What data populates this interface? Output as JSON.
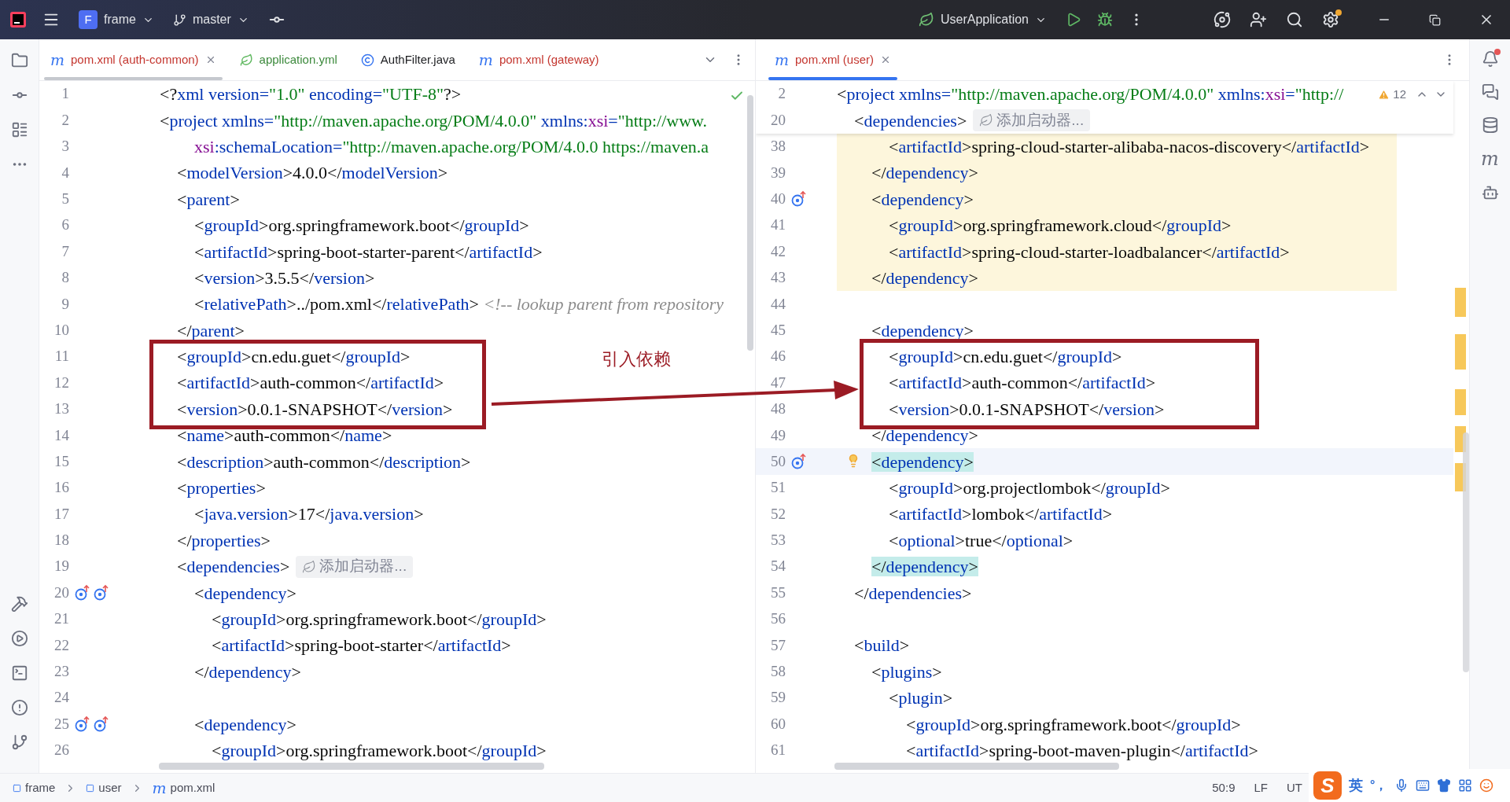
{
  "title_bar": {
    "project": {
      "badge": "F",
      "name": "frame"
    },
    "branch": "master",
    "run_config": "UserApplication"
  },
  "right_toolbar": {
    "maven_label": "m"
  },
  "left_editor": {
    "focused": false,
    "tabs": [
      {
        "kind": "maven",
        "icon_text": "m",
        "label": "pom.xml (auth-common)",
        "color": "#c4362f",
        "selected": true
      },
      {
        "kind": "yaml",
        "label": "application.yml",
        "color": "#3d8a3d",
        "selected": false
      },
      {
        "kind": "java",
        "label": "AuthFilter.java",
        "color": "#1e1f22",
        "selected": false
      },
      {
        "kind": "maven",
        "icon_text": "m",
        "label": "pom.xml (gateway)",
        "color": "#c4362f",
        "selected": false
      }
    ],
    "lines": [
      {
        "n": "1",
        "text": "<?xml version=\"1.0\" encoding=\"UTF-8\"?>"
      },
      {
        "n": "2",
        "text": "<project xmlns=\"http://maven.apache.org/POM/4.0.0\" xmlns:xsi=\"http://www."
      },
      {
        "n": "3",
        "text": "        xsi:schemaLocation=\"http://maven.apache.org/POM/4.0.0 https://maven.a"
      },
      {
        "n": "4",
        "text": "    <modelVersion>4.0.0</modelVersion>"
      },
      {
        "n": "5",
        "text": "    <parent>"
      },
      {
        "n": "6",
        "text": "        <groupId>org.springframework.boot</groupId>"
      },
      {
        "n": "7",
        "text": "        <artifactId>spring-boot-starter-parent</artifactId>"
      },
      {
        "n": "8",
        "text": "        <version>3.5.5</version>"
      },
      {
        "n": "9",
        "text": "        <relativePath>../pom.xml</relativePath> <!-- lookup parent from repository"
      },
      {
        "n": "10",
        "text": "    </parent>"
      },
      {
        "n": "11",
        "text": "    <groupId>cn.edu.guet</groupId>"
      },
      {
        "n": "12",
        "text": "    <artifactId>auth-common</artifactId>"
      },
      {
        "n": "13",
        "text": "    <version>0.0.1-SNAPSHOT</version>"
      },
      {
        "n": "14",
        "text": "    <name>auth-common</name>"
      },
      {
        "n": "15",
        "text": "    <description>auth-common</description>"
      },
      {
        "n": "16",
        "text": "    <properties>"
      },
      {
        "n": "17",
        "text": "        <java.version>17</java.version>"
      },
      {
        "n": "18",
        "text": "    </properties>"
      },
      {
        "n": "19",
        "text": "    <dependencies>",
        "hint": "添加启动器..."
      },
      {
        "n": "20",
        "text": "        <dependency>",
        "markers": [
          {
            "kind": "override"
          },
          {
            "kind": "override"
          }
        ]
      },
      {
        "n": "21",
        "text": "            <groupId>org.springframework.boot</groupId>"
      },
      {
        "n": "22",
        "text": "            <artifactId>spring-boot-starter</artifactId>"
      },
      {
        "n": "23",
        "text": "        </dependency>"
      },
      {
        "n": "24"
      },
      {
        "n": "25",
        "text": "        <dependency>",
        "markers": [
          {
            "kind": "override"
          },
          {
            "kind": "override"
          }
        ]
      },
      {
        "n": "26",
        "text": "            <groupId>org.springframework.boot</groupId>"
      }
    ]
  },
  "right_editor": {
    "focused": true,
    "tabs": [
      {
        "kind": "maven",
        "icon_text": "m",
        "label": "pom.xml (user)",
        "color": "#c4362f",
        "selected": true
      }
    ],
    "inspection": {
      "count": "12"
    },
    "sticky_lines": [
      {
        "n": "2",
        "text": "<project xmlns=\"http://maven.apache.org/POM/4.0.0\" xmlns:xsi=\"http://"
      },
      {
        "n": "20",
        "text": "    <dependencies>",
        "hint": "添加启动器..."
      }
    ],
    "lines": [
      {
        "n": "38",
        "text": "            <artifactId>spring-cloud-starter-alibaba-nacos-discovery</artifactId>",
        "highlighted": true,
        "current": false,
        "tag_match": false
      },
      {
        "n": "39",
        "text": "        </dependency>",
        "highlighted": true,
        "current": false,
        "tag_match": false
      },
      {
        "n": "40",
        "text": "        <dependency>",
        "markers": [
          {
            "kind": "override"
          }
        ],
        "highlighted": true,
        "current": false,
        "tag_match": false
      },
      {
        "n": "41",
        "text": "            <groupId>org.springframework.cloud</groupId>",
        "highlighted": true,
        "current": false,
        "tag_match": false
      },
      {
        "n": "42",
        "text": "            <artifactId>spring-cloud-starter-loadbalancer</artifactId>",
        "highlighted": true,
        "current": false,
        "tag_match": false
      },
      {
        "n": "43",
        "text": "        </dependency>",
        "highlighted": true,
        "current": false,
        "tag_match": false
      },
      {
        "n": "44",
        "highlighted": false,
        "current": false
      },
      {
        "n": "45",
        "text": "        <dependency>",
        "highlighted": false,
        "current": false,
        "tag_match": false
      },
      {
        "n": "46",
        "text": "            <groupId>cn.edu.guet</groupId>",
        "highlighted": false,
        "current": false,
        "tag_match": false
      },
      {
        "n": "47",
        "text": "            <artifactId>auth-common</artifactId>",
        "highlighted": false,
        "current": false,
        "tag_match": false
      },
      {
        "n": "48",
        "text": "            <version>0.0.1-SNAPSHOT</version>",
        "highlighted": false,
        "current": false,
        "tag_match": false
      },
      {
        "n": "49",
        "text": "        </dependency>",
        "highlighted": false,
        "current": false,
        "tag_match": false
      },
      {
        "n": "50",
        "text": "        <dependency>",
        "markers": [
          {
            "kind": "override"
          },
          {
            "kind": "bulb"
          }
        ],
        "highlighted": false,
        "current": true,
        "tag_match": true
      },
      {
        "n": "51",
        "text": "            <groupId>org.projectlombok</groupId>",
        "highlighted": false,
        "current": false,
        "tag_match": false
      },
      {
        "n": "52",
        "text": "            <artifactId>lombok</artifactId>",
        "highlighted": false,
        "current": false,
        "tag_match": false
      },
      {
        "n": "53",
        "text": "            <optional>true</optional>",
        "highlighted": false,
        "current": false,
        "tag_match": false
      },
      {
        "n": "54",
        "text": "        </dependency>",
        "highlighted": false,
        "current": false,
        "tag_match": true
      },
      {
        "n": "55",
        "text": "    </dependencies>",
        "highlighted": false,
        "current": false,
        "tag_match": false
      },
      {
        "n": "56",
        "highlighted": false,
        "current": false
      },
      {
        "n": "57",
        "text": "    <build>",
        "highlighted": false,
        "current": false,
        "tag_match": false
      },
      {
        "n": "58",
        "text": "        <plugins>",
        "highlighted": false,
        "current": false,
        "tag_match": false
      },
      {
        "n": "59",
        "text": "            <plugin>",
        "highlighted": false,
        "current": false,
        "tag_match": false
      },
      {
        "n": "60",
        "text": "                <groupId>org.springframework.boot</groupId>",
        "highlighted": false,
        "current": false,
        "tag_match": false
      },
      {
        "n": "61",
        "text": "                <artifactId>spring-boot-maven-plugin</artifactId>",
        "highlighted": false,
        "current": false,
        "tag_match": false
      }
    ]
  },
  "annotation": {
    "label": "引入依赖"
  },
  "status_bar": {
    "breadcrumbs": [
      {
        "kind": "module",
        "label": "frame"
      },
      {
        "kind": "module",
        "label": "user"
      },
      {
        "kind": "maven",
        "icon_text": "m",
        "label": "pom.xml"
      }
    ],
    "position": "50:9",
    "line_separator": "LF",
    "encoding": "UT"
  },
  "ime_toolbar": {
    "logo": "S",
    "mode": "英",
    "punctuation": "°，"
  }
}
